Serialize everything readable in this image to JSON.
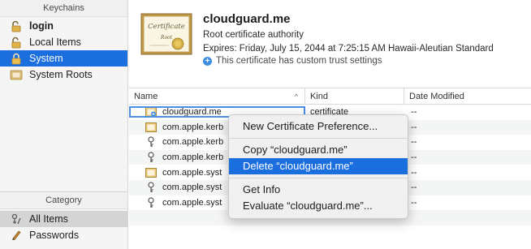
{
  "sidebar": {
    "keychains_header": "Keychains",
    "keychains": [
      {
        "label": "login",
        "icon": "lock-open-icon"
      },
      {
        "label": "Local Items",
        "icon": "lock-open-icon"
      },
      {
        "label": "System",
        "icon": "lock-icon"
      },
      {
        "label": "System Roots",
        "icon": "folder-icon"
      }
    ],
    "category_header": "Category",
    "categories": [
      {
        "label": "All Items",
        "icon": "all-items-icon"
      },
      {
        "label": "Passwords",
        "icon": "pen-icon"
      }
    ]
  },
  "certificate": {
    "image_label_top": "Certificate",
    "image_label_mid": "Root",
    "name": "cloudguard.me",
    "type": "Root certificate authority",
    "expires": "Expires: Friday, July 15, 2044 at 7:25:15 AM Hawaii-Aleutian Standard",
    "trust_note": "This certificate has custom trust settings",
    "trust_icon_glyph": "+"
  },
  "table": {
    "columns": {
      "name": "Name",
      "kind": "Kind",
      "date": "Date Modified"
    },
    "sort_glyph": "^",
    "rows": [
      {
        "name": "cloudguard.me",
        "kind": "certificate",
        "date": "--",
        "icon": "certificate-icon"
      },
      {
        "name": "com.apple.kerb",
        "kind": "",
        "date": "--",
        "icon": "certificate-icon"
      },
      {
        "name": "com.apple.kerb",
        "kind": "",
        "date": "--",
        "icon": "key-icon"
      },
      {
        "name": "com.apple.kerb",
        "kind": "",
        "date": "--",
        "icon": "key-icon"
      },
      {
        "name": "com.apple.syst",
        "kind": "",
        "date": "--",
        "icon": "certificate-icon"
      },
      {
        "name": "com.apple.syst",
        "kind": "",
        "date": "--",
        "icon": "key-icon"
      },
      {
        "name": "com.apple.syst",
        "kind": "",
        "date": "--",
        "icon": "key-icon"
      }
    ]
  },
  "context_menu": {
    "new_pref": "New Certificate Preference...",
    "copy": "Copy “cloudguard.me”",
    "delete": "Delete “cloudguard.me”",
    "get_info": "Get Info",
    "evaluate": "Evaluate “cloudguard.me”..."
  },
  "colors": {
    "selection": "#1a6ede",
    "accent_blue": "#3c8fdf"
  }
}
